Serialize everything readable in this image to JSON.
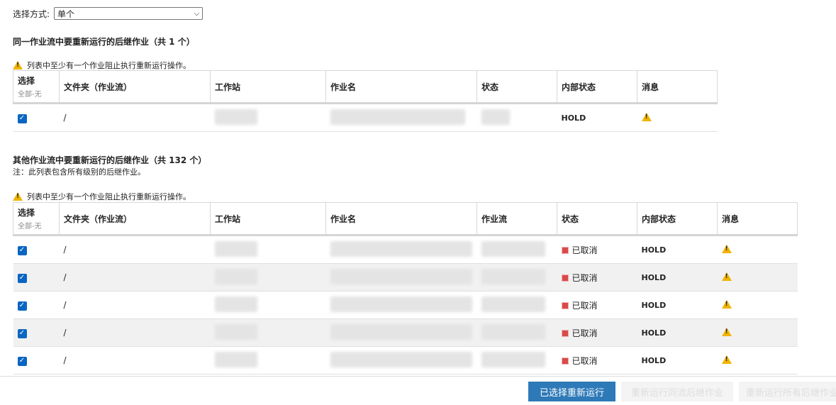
{
  "selection_mode": {
    "label": "选择方式:",
    "value": "单个"
  },
  "same_flow": {
    "title": "同一作业流中要重新运行的后继作业（共 1 个）",
    "warning": "列表中至少有一个作业阻止执行重新运行操作。",
    "headers": {
      "select": "选择",
      "select_all": "全部",
      "select_none": "无",
      "folder": "文件夹（作业流）",
      "workstation": "工作站",
      "job_name": "作业名",
      "status": "状态",
      "internal_status": "内部状态",
      "message": "消息"
    },
    "rows": [
      {
        "folder": "/",
        "internal_status": "HOLD"
      }
    ]
  },
  "other_flows": {
    "title": "其他作业流中要重新运行的后继作业（共 132 个）",
    "note": "注：此列表包含所有级别的后继作业。",
    "warning": "列表中至少有一个作业阻止执行重新运行操作。",
    "headers": {
      "select": "选择",
      "select_all": "全部",
      "select_none": "无",
      "folder": "文件夹（作业流）",
      "workstation": "工作站",
      "job_name": "作业名",
      "job_stream": "作业流",
      "status": "状态",
      "internal_status": "内部状态",
      "message": "消息"
    },
    "rows": [
      {
        "folder": "/",
        "status": "已取消",
        "internal_status": "HOLD"
      },
      {
        "folder": "/",
        "status": "已取消",
        "internal_status": "HOLD"
      },
      {
        "folder": "/",
        "status": "已取消",
        "internal_status": "HOLD"
      },
      {
        "folder": "/",
        "status": "已取消",
        "internal_status": "HOLD"
      },
      {
        "folder": "/",
        "status": "已取消",
        "internal_status": "HOLD"
      }
    ]
  },
  "buttons": {
    "rerun_selected": "已选择重新运行",
    "rerun_same_flow": "重新运行同流后继作业",
    "rerun_all": "重新运行所有后继作业"
  },
  "colors": {
    "primary": "#2e7ab8",
    "warning": "#f0b400",
    "status_cancelled": "#d84b4b"
  }
}
